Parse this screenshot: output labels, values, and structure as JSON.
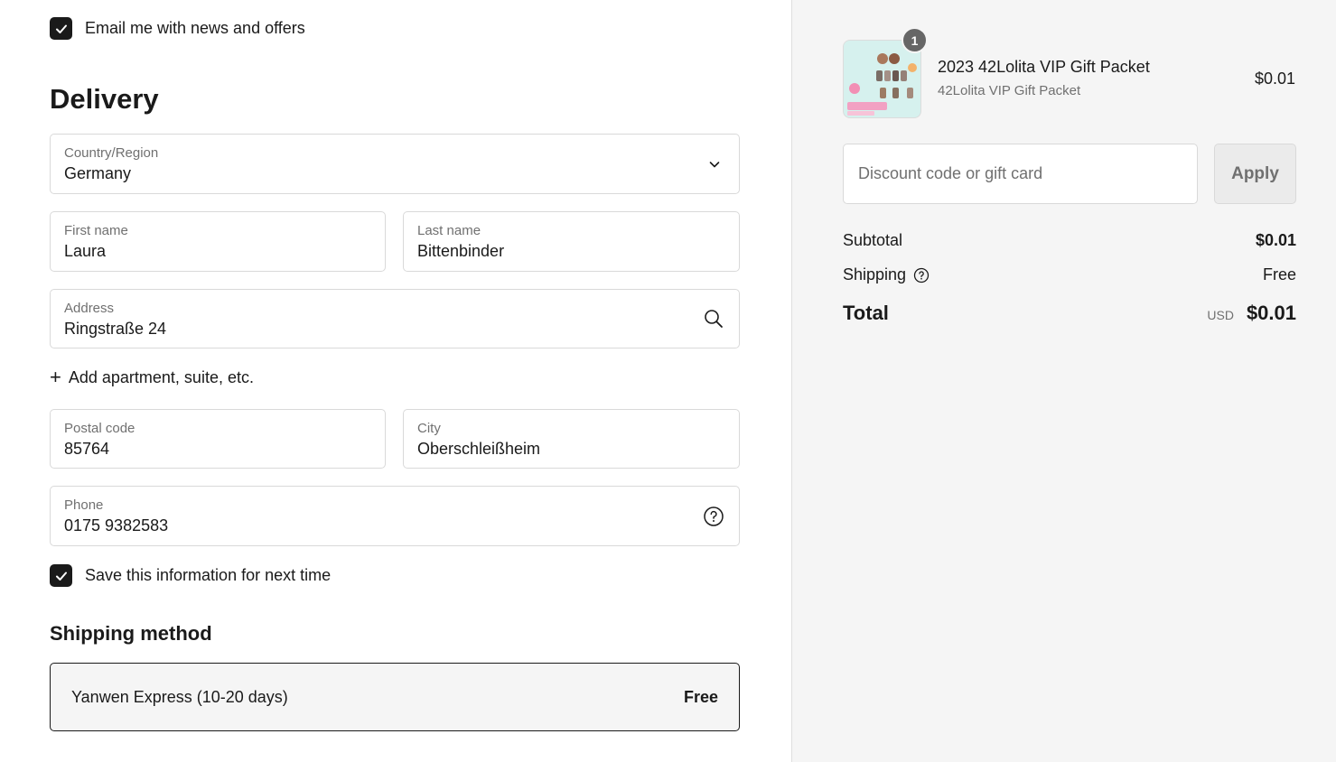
{
  "marketing": {
    "checkbox_label": "Email me with news and offers",
    "checked": true
  },
  "delivery": {
    "heading": "Delivery",
    "country": {
      "label": "Country/Region",
      "value": "Germany"
    },
    "first_name": {
      "label": "First name",
      "value": "Laura"
    },
    "last_name": {
      "label": "Last name",
      "value": "Bittenbinder"
    },
    "address": {
      "label": "Address",
      "value": "Ringstraße 24"
    },
    "add_apartment": {
      "icon": "plus-icon",
      "label": "Add apartment, suite, etc."
    },
    "postal_code": {
      "label": "Postal code",
      "value": "85764"
    },
    "city": {
      "label": "City",
      "value": "Oberschleißheim"
    },
    "phone": {
      "label": "Phone",
      "value": "0175 9382583"
    },
    "save_info": {
      "label": "Save this information for next time",
      "checked": true
    }
  },
  "shipping_method": {
    "heading": "Shipping method",
    "option": {
      "name": "Yanwen Express (10-20 days)",
      "price": "Free"
    }
  },
  "order_summary": {
    "item": {
      "quantity": "1",
      "title": "2023 42Lolita VIP Gift Packet",
      "variant": "42Lolita VIP Gift Packet",
      "price": "$0.01"
    },
    "discount": {
      "placeholder": "Discount code or gift card",
      "apply_label": "Apply"
    },
    "subtotal": {
      "label": "Subtotal",
      "value": "$0.01"
    },
    "shipping": {
      "label": "Shipping",
      "value": "Free"
    },
    "total": {
      "label": "Total",
      "currency": "USD",
      "value": "$0.01"
    }
  },
  "colors": {
    "text": "#1a1a1a",
    "muted": "#707070",
    "border": "#d9d9d9",
    "sidebar_bg": "#f5f5f5",
    "badge_bg": "#666666"
  }
}
